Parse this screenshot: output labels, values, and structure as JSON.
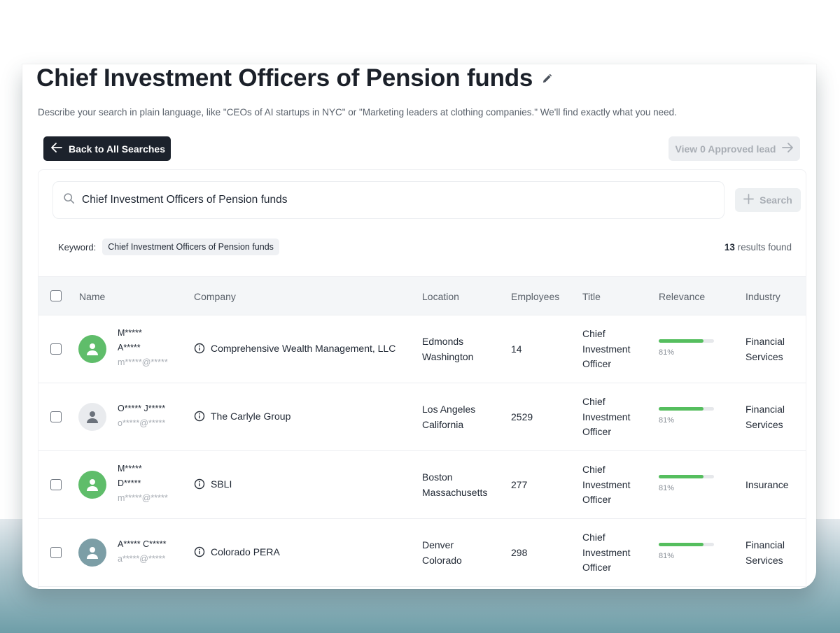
{
  "header": {
    "title": "Chief Investment Officers of Pension funds",
    "description": "Describe your search in plain language, like \"CEOs of AI startups in NYC\" or \"Marketing leaders at clothing companies.\" We'll find exactly what you need."
  },
  "toolbar": {
    "back_label": "Back to All Searches",
    "approved_label": "View 0 Approved lead"
  },
  "search": {
    "value": "Chief Investment Officers of Pension funds",
    "button_label": "Search"
  },
  "filters": {
    "keyword_label": "Keyword:",
    "keyword_value": "Chief Investment Officers of Pension funds"
  },
  "results": {
    "count": "13",
    "suffix": " results found"
  },
  "table": {
    "columns": [
      "Name",
      "Company",
      "Location",
      "Employees",
      "Title",
      "Relevance",
      "Industry"
    ],
    "rows": [
      {
        "name_line1": "M*****",
        "name_line2": "A*****",
        "email": "m*****@*****",
        "avatar_color": "#5fbd6a",
        "company": "Comprehensive Wealth Management, LLC",
        "location_city": "Edmonds",
        "location_state": "Washington",
        "employees": "14",
        "title_1": "Chief",
        "title_2": "Investment",
        "title_3": "Officer",
        "relevance_pct": 81,
        "relevance_label": "81%",
        "industry_1": "Financial",
        "industry_2": "Services"
      },
      {
        "name_line1": "O***** J*****",
        "name_line2": "",
        "email": "o*****@*****",
        "avatar_color": "#e9ebee",
        "company": "The Carlyle Group",
        "location_city": "Los Angeles",
        "location_state": "California",
        "employees": "2529",
        "title_1": "Chief",
        "title_2": "Investment",
        "title_3": "Officer",
        "relevance_pct": 81,
        "relevance_label": "81%",
        "industry_1": "Financial",
        "industry_2": "Services"
      },
      {
        "name_line1": "M*****",
        "name_line2": "D*****",
        "email": "m*****@*****",
        "avatar_color": "#5fbd6a",
        "company": "SBLI",
        "location_city": "Boston",
        "location_state": "Massachusetts",
        "employees": "277",
        "title_1": "Chief",
        "title_2": "Investment",
        "title_3": "Officer",
        "relevance_pct": 81,
        "relevance_label": "81%",
        "industry_1": "Insurance",
        "industry_2": ""
      },
      {
        "name_line1": "A***** C*****",
        "name_line2": "",
        "email": "a*****@*****",
        "avatar_color": "#7c9ea6",
        "company": "Colorado PERA",
        "location_city": "Denver",
        "location_state": "Colorado",
        "employees": "298",
        "title_1": "Chief",
        "title_2": "Investment",
        "title_3": "Officer",
        "relevance_pct": 81,
        "relevance_label": "81%",
        "industry_1": "Financial",
        "industry_2": "Services"
      }
    ]
  },
  "colors": {
    "primary_dark": "#1c222c",
    "relevance_bar": "#55be5e",
    "avatar_green": "#5fbd6a",
    "avatar_teal": "#7c9ea6"
  }
}
